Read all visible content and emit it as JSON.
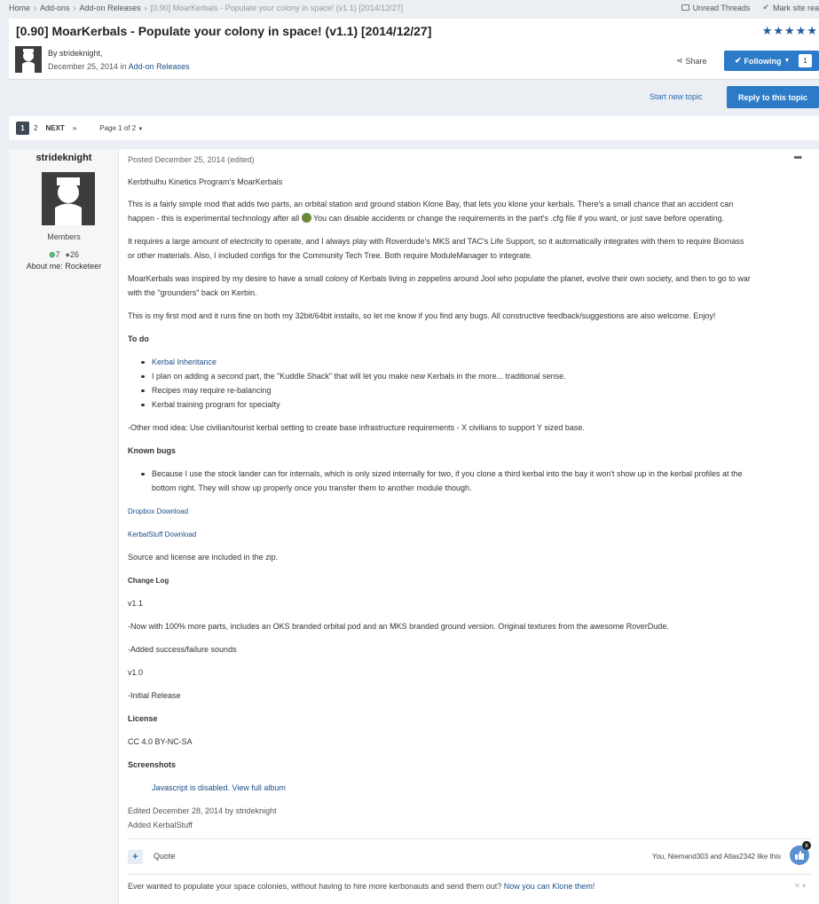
{
  "breadcrumb": [
    "Home",
    "Add-ons",
    "Add-on Releases",
    "[0.90] MoarKerbals - Populate your colony in space! (v1.1) [2014/12/27]"
  ],
  "top_links": {
    "unread": "Unread Threads",
    "mark_read": "Mark site rea"
  },
  "topic": {
    "title": "[0.90] MoarKerbals - Populate your colony in space! (v1.1) [2014/12/27]",
    "by": "By strideknight,",
    "date": "December 25, 2014",
    "in_word": "in",
    "forum": "Add-on Releases",
    "share": "Share",
    "following": "Following",
    "follow_count": "1",
    "rating": 5
  },
  "actions": {
    "start_topic": "Start new topic",
    "reply": "Reply to this topic"
  },
  "pagination": {
    "current": "1",
    "page2": "2",
    "next": "NEXT",
    "last": "»",
    "page_label": "Page 1 of 2"
  },
  "author": {
    "name": "strideknight",
    "group": "Members",
    "rep": "7",
    "posts": "26",
    "about": "About me: Rocketeer"
  },
  "post": {
    "meta": "Posted December 25, 2014 (edited)",
    "menu": "•••",
    "heading": "Kerbthulhu Kinetics Program's MoarKerbals",
    "p1a": "This is a fairly simple mod that adds two parts, an orbital station and ground station Klone Bay, that lets you klone your kerbals. There's a small chance that an accident can",
    "p1b": "happen - this is experimental technology after all",
    "p1c": "You can disable accidents or change the requirements in the part's .cfg file if you want, or just save before operating.",
    "p2a": "It requires a large amount of electricity to operate, and I always play with Roverdude's MKS and TAC's Life Support, so it automatically integrates with them to require Biomass",
    "p2b": "or other materials. Also, I included configs for the Community Tech Tree. Both require ModuleManager to integrate.",
    "p3a": "MoarKerbals was inspired by my desire to have a small colony of Kerbals living in zeppelins around Jool who populate the planet, evolve their own society, and then to go to war",
    "p3b": "with the \"grounders\" back on Kerbin.",
    "p4": "This is my first mod and it runs fine on both my 32bit/64bit installs, so let me know if you find any bugs. All constructive feedback/suggestions are also welcome. Enjoy!",
    "todo_title": "To do",
    "todo": [
      "Kerbal Inheritance",
      "I plan on adding a second part, the \"Kuddle Shack\" that will let you make new Kerbals in the more... traditional sense.",
      "Recipes may require re-balancing",
      "Kerbal training program for specialty"
    ],
    "other_idea": "-Other mod idea: Use civilian/tourist kerbal setting to create base infrastructure requirements - X civilians to support Y sized base.",
    "bugs_title": "Known bugs",
    "bug1a": "Because I use the stock lander can for internals, which is only sized internally for two, if you clone a third kerbal into the bay it won't show up in the kerbal profiles at the",
    "bug1b": "bottom right. They will show up properly once you transfer them to another module though.",
    "dropbox": "Dropbox Download",
    "kerbalstuff": "KerbalStuff Download",
    "source": "Source and license are included in the zip.",
    "changelog": "Change Log",
    "v11": "v1.1",
    "v11_note1": "-Now with 100% more parts, includes an OKS branded orbital pod and an MKS branded ground version. Original textures from the awesome RoverDude.",
    "v11_note2": "-Added success/failure sounds",
    "v10": "v1.0",
    "v10_note": "-Initial Release",
    "license_title": "License",
    "license": "CC 4.0 BY-NC-SA",
    "screens_title": "Screenshots",
    "album": "Javascript is disabled. View full album",
    "edited": "Edited December 28, 2014 by strideknight",
    "edit_reason": "Added KerbalStuff",
    "quote": "Quote",
    "likes": "You, Niemand303 and Atlas2342 like this",
    "signature_text": "Ever wanted to populate your space colonies, without having to hire more kerbonauts and send them out?",
    "signature_link": "Now you can Klone them!"
  }
}
